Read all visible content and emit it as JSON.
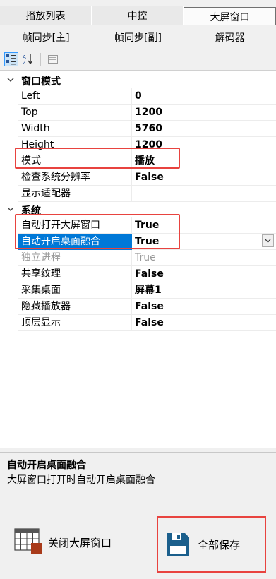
{
  "tabs_row1": [
    {
      "label": "播放列表",
      "active": false
    },
    {
      "label": "中控",
      "active": false
    },
    {
      "label": "大屏窗口",
      "active": true
    }
  ],
  "tabs_row2": [
    {
      "label": "帧同步[主]"
    },
    {
      "label": "帧同步[副]"
    },
    {
      "label": "解码器"
    }
  ],
  "toolbar": {
    "categorized_icon": "categorized-icon",
    "alphabetical_icon": "sort-az-icon",
    "property_pages_icon": "property-pages-icon"
  },
  "grid": {
    "cat_window_mode": "窗口模式",
    "cat_system": "系统",
    "props": {
      "left": {
        "name": "Left",
        "value": "0"
      },
      "top": {
        "name": "Top",
        "value": "1200"
      },
      "width": {
        "name": "Width",
        "value": "5760"
      },
      "height": {
        "name": "Height",
        "value": "1200"
      },
      "mode": {
        "name": "模式",
        "value": "播放"
      },
      "check_resolution": {
        "name": "检查系统分辨率",
        "value": "False"
      },
      "display_adapter": {
        "name": "显示适配器",
        "value": ""
      },
      "auto_open": {
        "name": "自动打开大屏窗口",
        "value": "True"
      },
      "auto_blend": {
        "name": "自动开启桌面融合",
        "value": "True"
      },
      "standalone": {
        "name": "独立进程",
        "value": "True"
      },
      "shared_texture": {
        "name": "共享纹理",
        "value": "False"
      },
      "capture_desktop": {
        "name": "采集桌面",
        "value": "屏幕1"
      },
      "hide_player": {
        "name": "隐藏播放器",
        "value": "False"
      },
      "topmost": {
        "name": "顶层显示",
        "value": "False"
      }
    }
  },
  "description": {
    "title": "自动开启桌面融合",
    "text": "大屏窗口打开时自动开启桌面融合"
  },
  "buttons": {
    "close_label": "关闭大屏窗口",
    "save_label": "全部保存"
  },
  "colors": {
    "selection": "#0078d7",
    "highlight_box": "#e8433f",
    "save_icon": "#1b5f8c",
    "close_icon_accent": "#a83a1a"
  }
}
